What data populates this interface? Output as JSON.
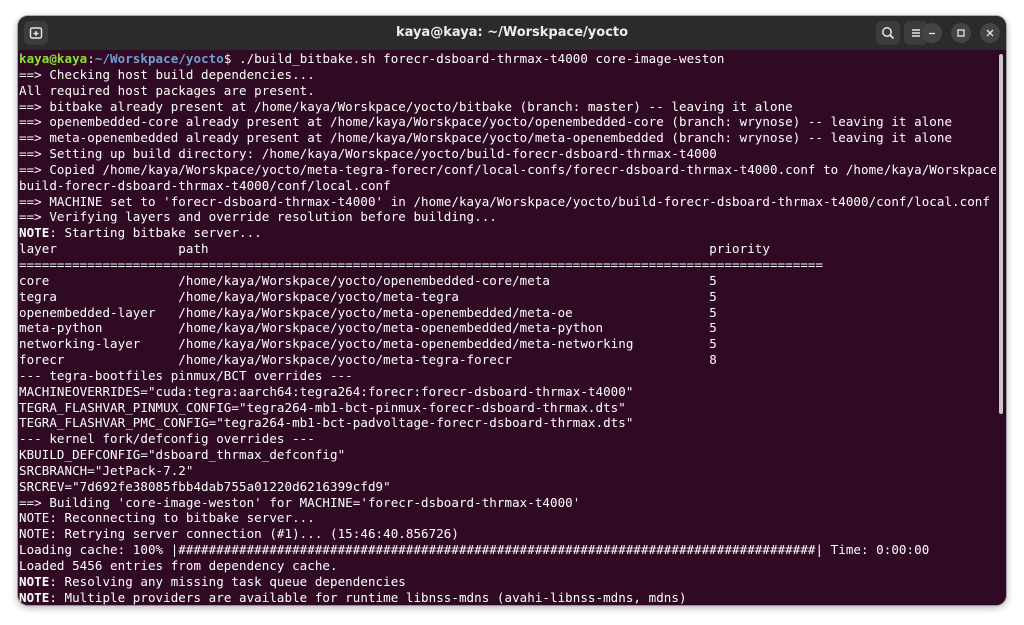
{
  "window": {
    "title": "kaya@kaya: ~/Worskpace/yocto"
  },
  "titlebar": {
    "new_tab_icon": "new-tab-icon",
    "search_icon": "search-icon",
    "menu_icon": "hamburger-menu-icon",
    "minimize_icon": "minimize-icon",
    "maximize_icon": "maximize-icon",
    "close_icon": "close-icon"
  },
  "colors": {
    "terminal_bg": "#300a24",
    "prompt_user": "#8ae234",
    "prompt_path": "#729fcf",
    "text": "#ffffff",
    "titlebar_bg": "#2b2b2b"
  },
  "terminal": {
    "prompt": {
      "user": "kaya@kaya",
      "sep": ":",
      "path": "~/Worskpace/yocto",
      "symbol": "$ ",
      "command": "./build_bitbake.sh forecr-dsboard-thrmax-t4000 core-image-weston"
    },
    "lines": [
      {
        "text": "==> Checking host build dependencies..."
      },
      {
        "text": "All required host packages are present."
      },
      {
        "text": "==> bitbake already present at /home/kaya/Worskpace/yocto/bitbake (branch: master) -- leaving it alone"
      },
      {
        "text": "==> openembedded-core already present at /home/kaya/Worskpace/yocto/openembedded-core (branch: wrynose) -- leaving it alone"
      },
      {
        "text": "==> meta-openembedded already present at /home/kaya/Worskpace/yocto/meta-openembedded (branch: wrynose) -- leaving it alone"
      },
      {
        "text": "==> Setting up build directory: /home/kaya/Worskpace/yocto/build-forecr-dsboard-thrmax-t4000"
      },
      {
        "text": "==> Copied /home/kaya/Worskpace/yocto/meta-tegra-forecr/conf/local-confs/forecr-dsboard-thrmax-t4000.conf to /home/kaya/Worskpace/yocto/"
      },
      {
        "text": "build-forecr-dsboard-thrmax-t4000/conf/local.conf"
      },
      {
        "text": "==> MACHINE set to 'forecr-dsboard-thrmax-t4000' in /home/kaya/Worskpace/yocto/build-forecr-dsboard-thrmax-t4000/conf/local.conf"
      },
      {
        "text": "==> Verifying layers and override resolution before building..."
      },
      {
        "bold": "NOTE",
        "text": ": Starting bitbake server..."
      },
      {
        "text": "layer                path                                                                  priority"
      },
      {
        "text": "=========================================================================================================="
      },
      {
        "text": "core                 /home/kaya/Worskpace/yocto/openembedded-core/meta                     5"
      },
      {
        "text": "tegra                /home/kaya/Worskpace/yocto/meta-tegra                                 5"
      },
      {
        "text": "openembedded-layer   /home/kaya/Worskpace/yocto/meta-openembedded/meta-oe                  5"
      },
      {
        "text": "meta-python          /home/kaya/Worskpace/yocto/meta-openembedded/meta-python              5"
      },
      {
        "text": "networking-layer     /home/kaya/Worskpace/yocto/meta-openembedded/meta-networking          5"
      },
      {
        "text": "forecr               /home/kaya/Worskpace/yocto/meta-tegra-forecr                          8"
      },
      {
        "text": "--- tegra-bootfiles pinmux/BCT overrides ---"
      },
      {
        "text": "MACHINEOVERRIDES=\"cuda:tegra:aarch64:tegra264:forecr:forecr-dsboard-thrmax-t4000\""
      },
      {
        "text": "TEGRA_FLASHVAR_PINMUX_CONFIG=\"tegra264-mb1-bct-pinmux-forecr-dsboard-thrmax.dts\""
      },
      {
        "text": "TEGRA_FLASHVAR_PMC_CONFIG=\"tegra264-mb1-bct-padvoltage-forecr-dsboard-thrmax.dts\""
      },
      {
        "text": "--- kernel fork/defconfig overrides ---"
      },
      {
        "text": "KBUILD_DEFCONFIG=\"dsboard_thrmax_defconfig\""
      },
      {
        "text": "SRCBRANCH=\"JetPack-7.2\""
      },
      {
        "text": "SRCREV=\"7d692fe38085fbb4dab755a01220d6216399cfd9\""
      },
      {
        "text": "==> Building 'core-image-weston' for MACHINE='forecr-dsboard-thrmax-t4000'"
      },
      {
        "text": "NOTE: Reconnecting to bitbake server..."
      },
      {
        "text": "NOTE: Retrying server connection (#1)... (15:46:40.856726)"
      },
      {
        "text": "Loading cache: 100% |####################################################################################| Time: 0:00:00"
      },
      {
        "text": "Loaded 5456 entries from dependency cache."
      },
      {
        "bold": "NOTE",
        "text": ": Resolving any missing task queue dependencies"
      },
      {
        "bold": "NOTE",
        "text": ": Multiple providers are available for runtime libnss-mdns (avahi-libnss-mdns, mdns)"
      }
    ]
  }
}
